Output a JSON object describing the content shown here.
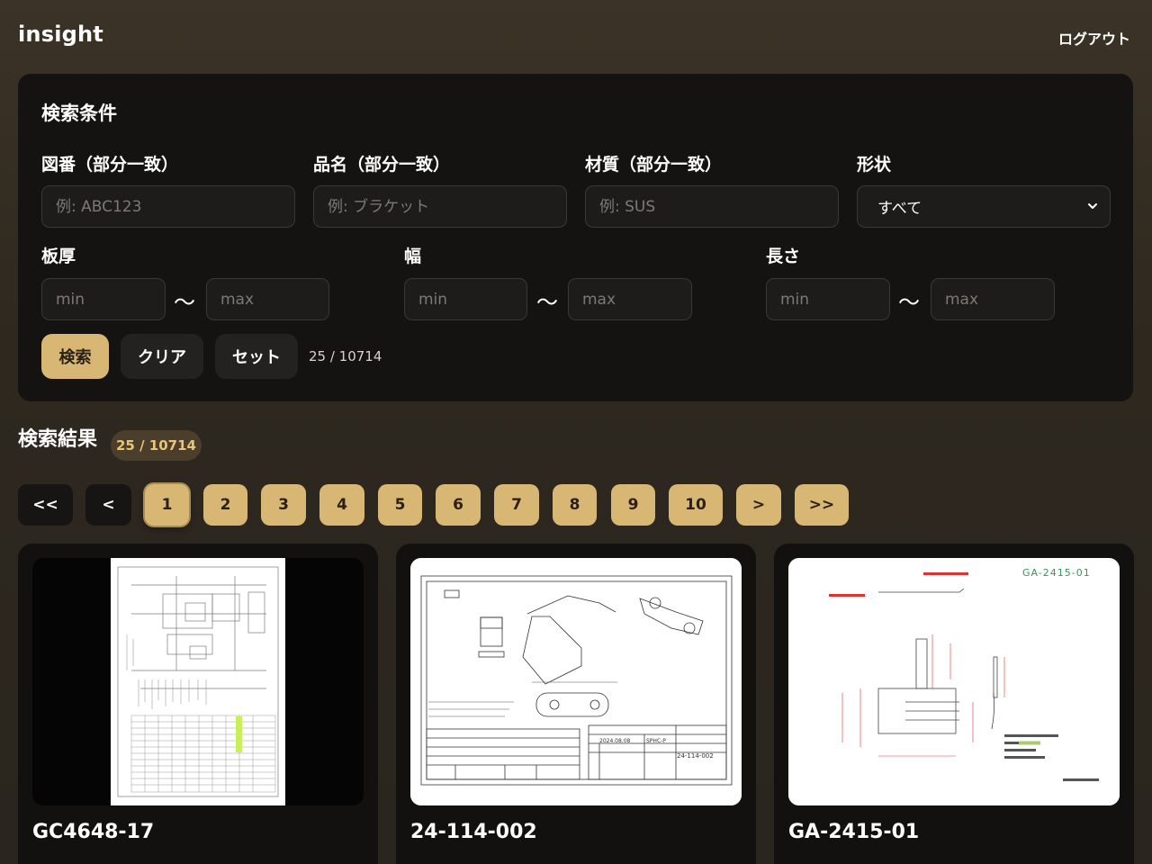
{
  "app": {
    "brand": "insight",
    "logout_label": "ログアウト"
  },
  "search": {
    "title": "検索条件",
    "drawing_no": {
      "label": "図番（部分一致）",
      "placeholder": "例: ABC123"
    },
    "item_name": {
      "label": "品名（部分一致）",
      "placeholder": "例: ブラケット"
    },
    "material": {
      "label": "材質（部分一致）",
      "placeholder": "例: SUS"
    },
    "shape": {
      "label": "形状",
      "selected": "すべて"
    },
    "thickness": {
      "label": "板厚",
      "min_placeholder": "min",
      "max_placeholder": "max"
    },
    "width": {
      "label": "幅",
      "min_placeholder": "min",
      "max_placeholder": "max"
    },
    "length": {
      "label": "長さ",
      "min_placeholder": "min",
      "max_placeholder": "max"
    },
    "range_separator": "〜",
    "search_button": "検索",
    "clear_button": "クリア",
    "set_button": "セット",
    "count_text": "25 / 10714"
  },
  "results": {
    "title": "検索結果",
    "badge": "25 / 10714"
  },
  "pagination": {
    "first": "<<",
    "prev": "<",
    "pages": [
      "1",
      "2",
      "3",
      "4",
      "5",
      "6",
      "7",
      "8",
      "9",
      "10"
    ],
    "current": "1",
    "next": ">",
    "last": ">>"
  },
  "cards": [
    {
      "title": "GC4648-17"
    },
    {
      "title": "24-114-002",
      "drawing_texts": [
        "24-114-002",
        "SPHC-P",
        "2024.08.08"
      ]
    },
    {
      "title": "GA-2415-01",
      "drawing_texts": [
        "GA-2415-01"
      ]
    }
  ],
  "colors": {
    "accent": "#d8b774",
    "panel": "#141311",
    "background": "#2e281f"
  }
}
